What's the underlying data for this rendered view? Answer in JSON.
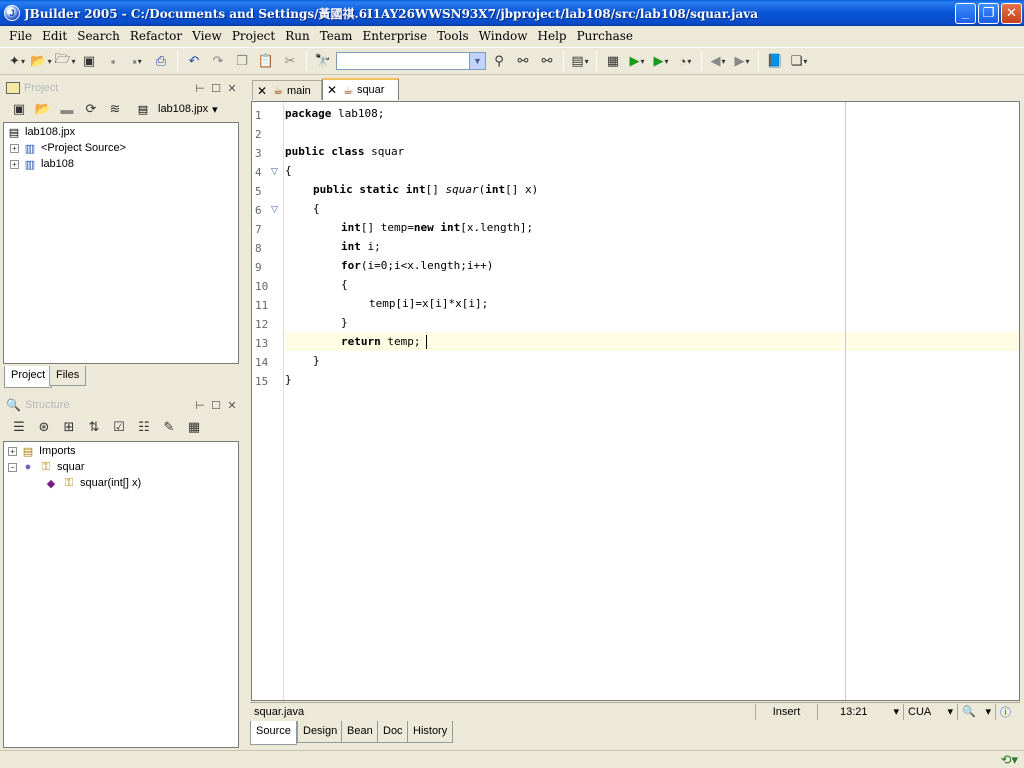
{
  "window": {
    "title": "JBuilder 2005 - C:/Documents and Settings/黃國祺.6I1AY26WWSN93X7/jbproject/lab108/src/lab108/squar.java",
    "app_icon_letter": "J"
  },
  "menu": [
    "File",
    "Edit",
    "Search",
    "Refactor",
    "View",
    "Project",
    "Run",
    "Team",
    "Enterprise",
    "Tools",
    "Window",
    "Help",
    "Purchase"
  ],
  "toolbar": {
    "search_combo_value": ""
  },
  "project_panel": {
    "title": "Project",
    "selector": "lab108.jpx",
    "tree": [
      {
        "label": "lab108.jpx",
        "icon": "project-file-icon"
      },
      {
        "label": "<Project Source>",
        "icon": "package-icon"
      },
      {
        "label": "lab108",
        "icon": "package-icon"
      }
    ],
    "tabs": [
      "Project",
      "Files"
    ]
  },
  "structure_panel": {
    "title": "Structure",
    "tree": [
      {
        "label": "Imports",
        "icon": "imports-icon"
      },
      {
        "label": "squar",
        "icon": "class-icon"
      },
      {
        "label": "squar(int[] x)",
        "icon": "method-icon"
      }
    ]
  },
  "editor": {
    "tabs": [
      {
        "label": "main",
        "active": false
      },
      {
        "label": "squar",
        "active": true
      }
    ],
    "line_numbers": [
      "1",
      "2",
      "3",
      "4",
      "5",
      "6",
      "7",
      "8",
      "9",
      "10",
      "11",
      "12",
      "13",
      "14",
      "15"
    ],
    "current_line": 13,
    "lines": {
      "l1a": "package",
      "l1b": " lab108;",
      "l3a": "public class",
      "l3b": " squar",
      "l4": "{",
      "l5a": "public static int",
      "l5b": "[] ",
      "l5c": "squar",
      "l5d": "(",
      "l5e": "int",
      "l5f": "[] x)",
      "l6": "{",
      "l7a": "int",
      "l7b": "[] temp=",
      "l7c": "new int",
      "l7d": "[x.length];",
      "l8a": "int",
      "l8b": " i;",
      "l9a": "for",
      "l9b": "(i=0;i<x.length;i++)",
      "l10": "{",
      "l11": "temp[i]=x[i]*x[i];",
      "l12": "}",
      "l13a": "return",
      "l13b": " temp;",
      "l14": "}",
      "l15": "}"
    }
  },
  "status": {
    "file": "squar.java",
    "mode": "Insert",
    "position": "13:21",
    "keymap": "CUA"
  },
  "view_tabs": [
    "Source",
    "Design",
    "Bean",
    "Doc",
    "History"
  ]
}
